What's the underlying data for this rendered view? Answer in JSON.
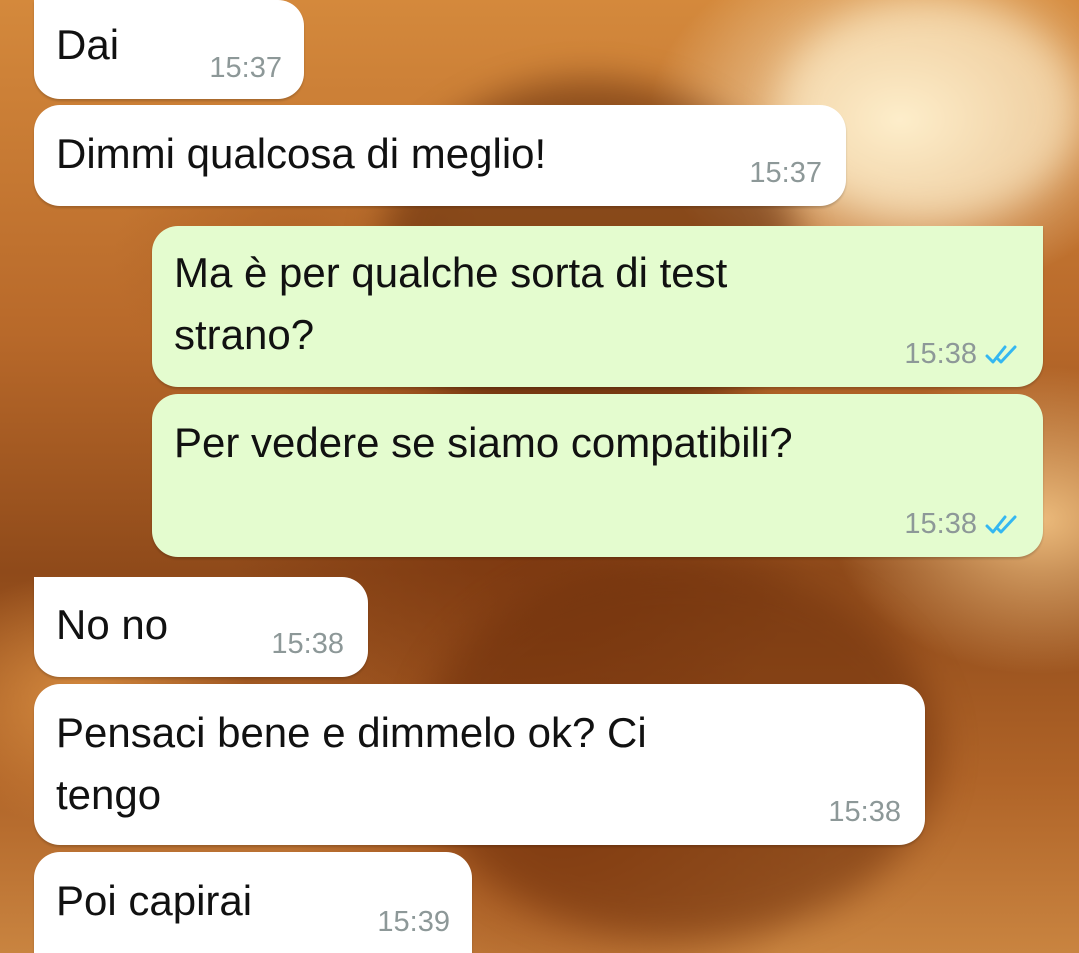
{
  "chat": {
    "messages": [
      {
        "direction": "incoming",
        "text": "Dai",
        "time": "15:37"
      },
      {
        "direction": "incoming",
        "text": "Dimmi qualcosa di meglio!",
        "time": "15:37"
      },
      {
        "direction": "outgoing",
        "text": "Ma è per qualche sorta di test\nstrano?",
        "time": "15:38",
        "status": "read"
      },
      {
        "direction": "outgoing",
        "text": "Per vedere se siamo compatibili?",
        "time": "15:38",
        "status": "read"
      },
      {
        "direction": "incoming",
        "text": "No no",
        "time": "15:38"
      },
      {
        "direction": "incoming",
        "text": "Pensaci bene e dimmelo ok? Ci\ntengo",
        "time": "15:38"
      },
      {
        "direction": "incoming",
        "text": "Poi capirai",
        "time": "15:39"
      }
    ]
  },
  "colors": {
    "incoming_bubble": "#ffffff",
    "outgoing_bubble": "#e4fccf",
    "read_ticks": "#34b7f1",
    "timestamp": "#8d9898"
  },
  "icons": {
    "read_status": "double-check-icon"
  }
}
